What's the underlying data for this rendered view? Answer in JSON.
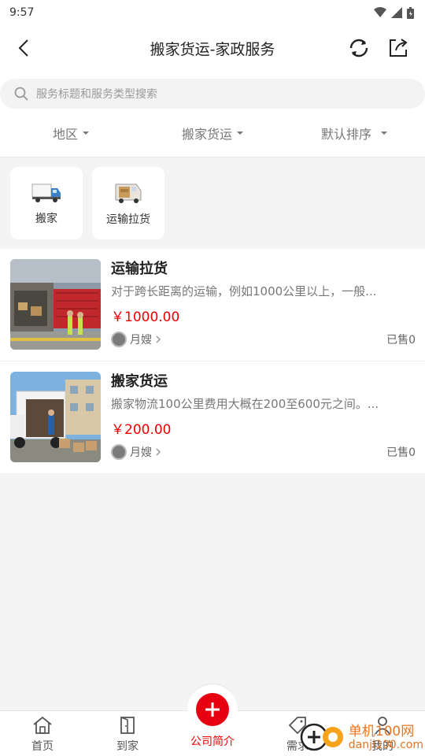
{
  "status": {
    "time": "9:57"
  },
  "header": {
    "title": "搬家货运-家政服务"
  },
  "search": {
    "placeholder": "服务标题和服务类型搜索"
  },
  "filters": [
    {
      "label": "地区"
    },
    {
      "label": "搬家货运"
    },
    {
      "label": "默认排序"
    }
  ],
  "categories": [
    {
      "label": "搬家",
      "icon": "truck-icon"
    },
    {
      "label": "运输拉货",
      "icon": "van-icon"
    }
  ],
  "items": [
    {
      "title": "运输拉货",
      "desc": "对于跨长距离的运输，例如1000公里以上，一般...",
      "price": "￥1000.00",
      "shop": "月嫂",
      "sold": "已售0"
    },
    {
      "title": "搬家货运",
      "desc": "搬家物流100公里费用大概在200至600元之间。...",
      "price": "￥200.00",
      "shop": "月嫂",
      "sold": "已售0"
    }
  ],
  "tabs": [
    {
      "label": "首页",
      "icon": "home-icon"
    },
    {
      "label": "到家",
      "icon": "door-icon"
    },
    {
      "label": "公司简介",
      "icon": "plus-icon"
    },
    {
      "label": "需求",
      "icon": "tag-icon"
    },
    {
      "label": "我的",
      "icon": "user-icon"
    }
  ],
  "watermark": {
    "line1": "单机100网",
    "line2": "danji100.com"
  },
  "colors": {
    "accent": "#e60012",
    "price": "#ee0000"
  }
}
